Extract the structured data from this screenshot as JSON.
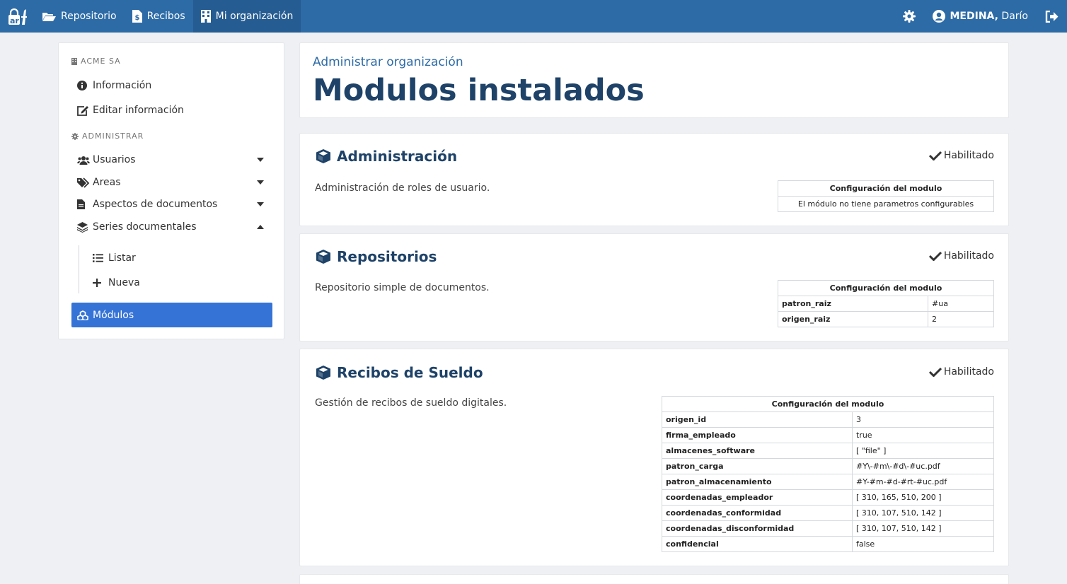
{
  "navbar": {
    "brand_icon": "arf-logo-icon",
    "items": [
      {
        "label": "Repositorio",
        "icon": "folder-open-icon"
      },
      {
        "label": "Recibos",
        "icon": "file-invoice-dollar-icon"
      },
      {
        "label": "Mi organización",
        "icon": "building-icon"
      }
    ],
    "user_last": "MEDINA,",
    "user_first": " Darío"
  },
  "sidebar": {
    "org_name": "ACME SA",
    "info_label": "Información",
    "edit_label": "Editar información",
    "admin_header": "ADMINISTRAR",
    "usuarios": "Usuarios",
    "areas": "Areas",
    "aspectos": "Aspectos de documentos",
    "series": "Series documentales",
    "listar": "Listar",
    "nueva": "Nueva",
    "modulos": "Módulos"
  },
  "page": {
    "subtitle": "Administrar organización",
    "title": "Modulos instalados"
  },
  "modules": {
    "status_label": "Habilitado",
    "config_header": "Configuración del modulo",
    "admin": {
      "name": "Administración",
      "description": "Administración de roles de usuario.",
      "no_params": "El módulo no tiene parametros configurables"
    },
    "repo": {
      "name": "Repositorios",
      "description": "Repositorio simple de documentos.",
      "params": [
        {
          "key": "patron_raiz",
          "value": "#ua"
        },
        {
          "key": "origen_raiz",
          "value": "2"
        }
      ]
    },
    "recibos": {
      "name": "Recibos de Sueldo",
      "description": "Gestión de recibos de sueldo digitales.",
      "params": [
        {
          "key": "origen_id",
          "value": "3"
        },
        {
          "key": "firma_empleado",
          "value": "true"
        },
        {
          "key": "almacenes_software",
          "value": "[ \"file\" ]"
        },
        {
          "key": "patron_carga",
          "value": "#Y\\-#m\\-#d\\-#uc.pdf"
        },
        {
          "key": "patron_almacenamiento",
          "value": "#Y-#m-#d-#rt-#uc.pdf"
        },
        {
          "key": "coordenadas_empleador",
          "value": "[ 310, 165, 510, 200 ]"
        },
        {
          "key": "coordenadas_conformidad",
          "value": "[ 310, 107, 510, 142 ]"
        },
        {
          "key": "coordenadas_disconformidad",
          "value": "[ 310, 107, 510, 142 ]"
        },
        {
          "key": "confidencial",
          "value": "false"
        }
      ]
    }
  }
}
